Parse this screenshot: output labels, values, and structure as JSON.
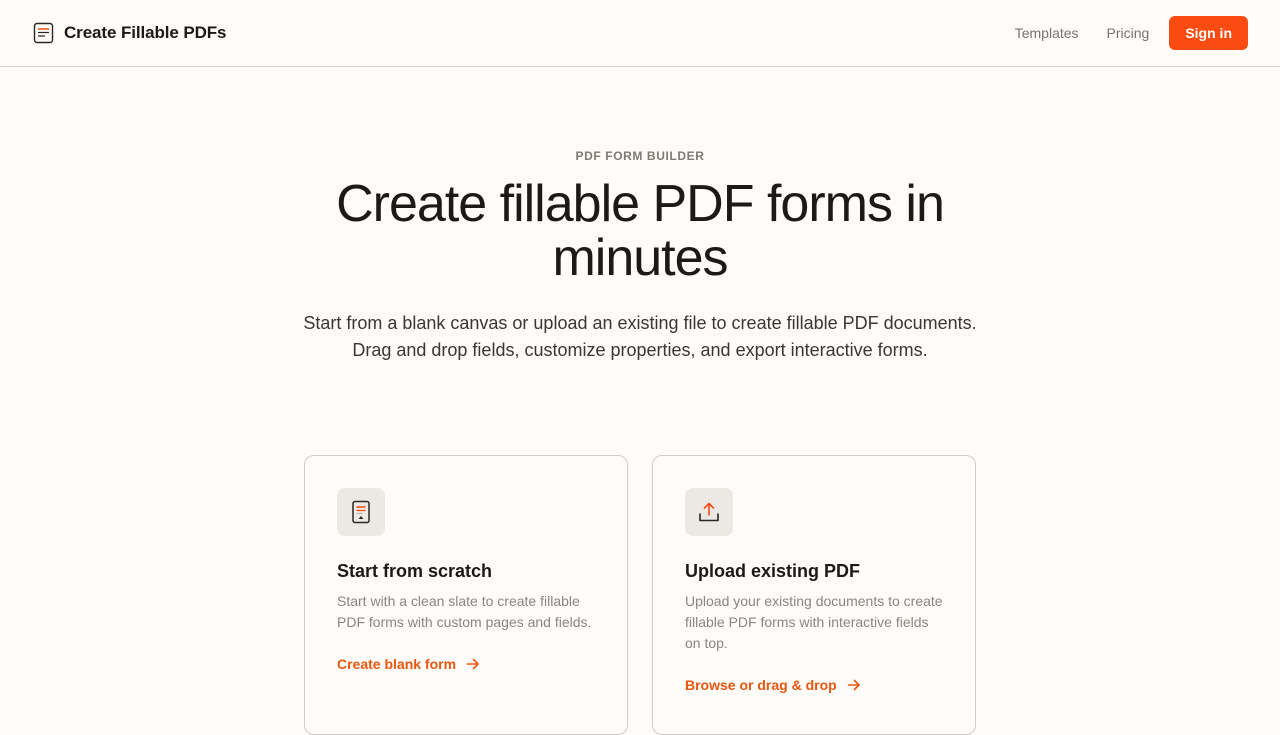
{
  "header": {
    "brand_name": "Create Fillable PDFs",
    "brand_icon": "document-icon",
    "nav": {
      "templates": "Templates",
      "pricing": "Pricing",
      "sign_in": "Sign in"
    }
  },
  "hero": {
    "eyebrow": "PDF FORM BUILDER",
    "title": "Create fillable PDF forms in minutes",
    "description": "Start from a blank canvas or upload an existing file to create fillable PDF documents. Drag and drop fields, customize properties, and export interactive forms."
  },
  "cards": [
    {
      "icon": "blank-document-icon",
      "title": "Start from scratch",
      "description": "Start with a clean slate to create fillable PDF forms with custom pages and fields.",
      "action": "Create blank form"
    },
    {
      "icon": "upload-icon",
      "title": "Upload existing PDF",
      "description": "Upload your existing documents to create fillable PDF forms with interactive fields on top.",
      "action": "Browse or drag & drop"
    }
  ],
  "colors": {
    "accent": "#fa4b10",
    "link_accent": "#e8560f",
    "background": "#fdfcf9"
  }
}
